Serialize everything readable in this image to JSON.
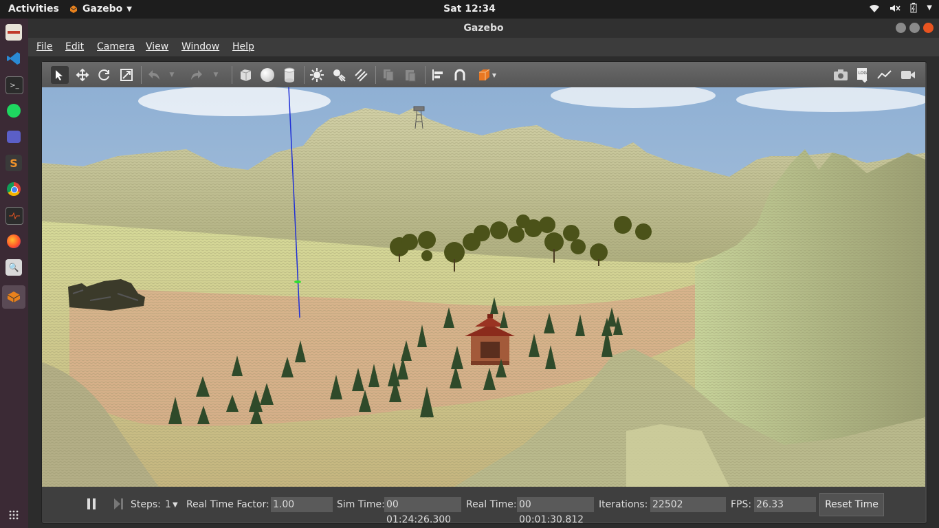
{
  "topbar": {
    "activities": "Activities",
    "app_name": "Gazebo",
    "clock": "Sat 12:34"
  },
  "window": {
    "title": "Gazebo"
  },
  "menu": {
    "items": [
      "File",
      "Edit",
      "Camera",
      "View",
      "Window",
      "Help"
    ]
  },
  "toolbar": {
    "log_label": "LOG"
  },
  "status": {
    "steps_label": "Steps:",
    "steps_value": "1",
    "rtf_label": "Real Time Factor:",
    "rtf_value": "1.00",
    "sim_time_label": "Sim Time:",
    "sim_time_value": "00 01:24:26.300",
    "real_time_label": "Real Time:",
    "real_time_value": "00 00:01:30.812",
    "iterations_label": "Iterations:",
    "iterations_value": "22502",
    "fps_label": "FPS:",
    "fps_value": "26.33",
    "reset_label": "Reset Time"
  },
  "colors": {
    "accent": "#e95420",
    "sky": "#a9c4de",
    "terrain": "#c9c79a"
  }
}
